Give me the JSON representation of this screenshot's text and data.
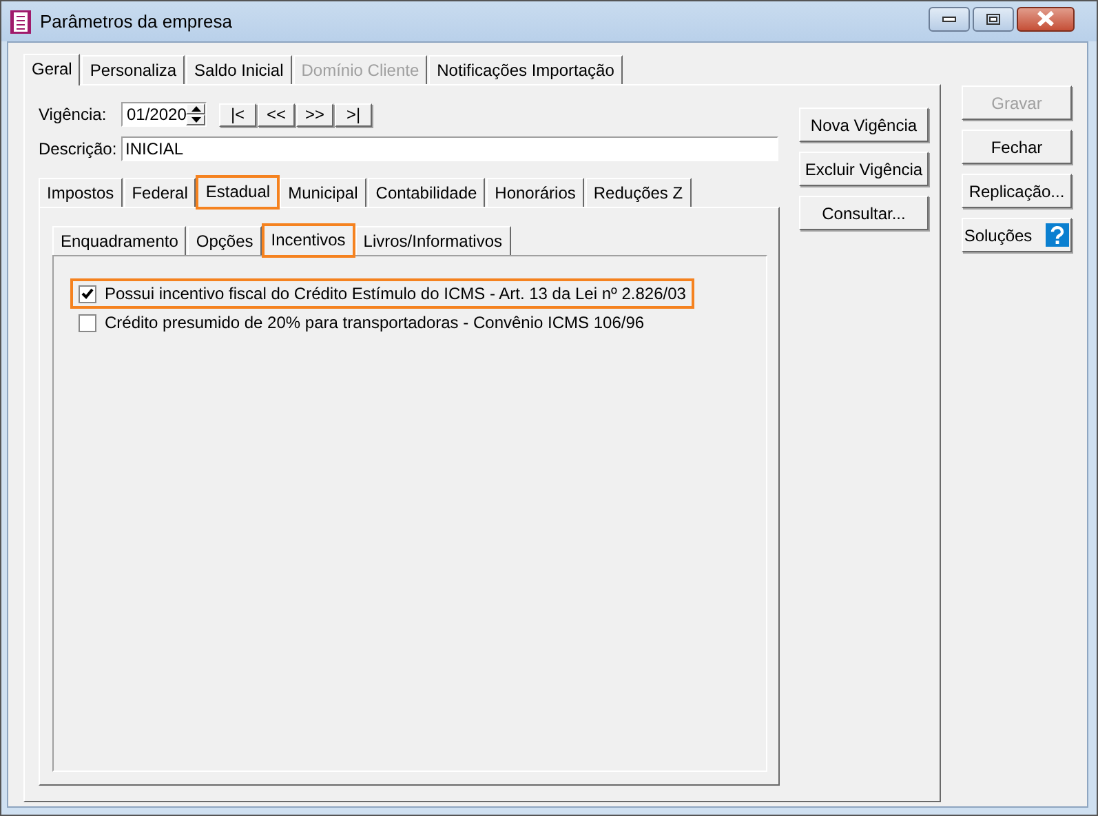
{
  "window": {
    "title": "Parâmetros da empresa"
  },
  "main_tabs": [
    {
      "label": "Geral",
      "selected": true,
      "disabled": false
    },
    {
      "label": "Personaliza",
      "selected": false,
      "disabled": false
    },
    {
      "label": "Saldo Inicial",
      "selected": false,
      "disabled": false
    },
    {
      "label": "Domínio Cliente",
      "selected": false,
      "disabled": true
    },
    {
      "label": "Notificações Importação",
      "selected": false,
      "disabled": false
    }
  ],
  "vigencia": {
    "label": "Vigência:",
    "value": "01/2020",
    "nav_buttons": [
      "|<",
      "<<",
      ">>",
      ">|"
    ]
  },
  "descricao": {
    "label": "Descrição:",
    "value": "INICIAL"
  },
  "tax_tabs": [
    {
      "label": "Impostos",
      "selected": false,
      "highlighted": false
    },
    {
      "label": "Federal",
      "selected": false,
      "highlighted": false
    },
    {
      "label": "Estadual",
      "selected": true,
      "highlighted": true
    },
    {
      "label": "Municipal",
      "selected": false,
      "highlighted": false
    },
    {
      "label": "Contabilidade",
      "selected": false,
      "highlighted": false
    },
    {
      "label": "Honorários",
      "selected": false,
      "highlighted": false
    },
    {
      "label": "Reduções Z",
      "selected": false,
      "highlighted": false
    }
  ],
  "state_tabs": [
    {
      "label": "Enquadramento",
      "selected": false,
      "highlighted": false
    },
    {
      "label": "Opções",
      "selected": false,
      "highlighted": false
    },
    {
      "label": "Incentivos",
      "selected": true,
      "highlighted": true
    },
    {
      "label": "Livros/Informativos",
      "selected": false,
      "highlighted": false
    }
  ],
  "incentives": [
    {
      "label": "Possui incentivo fiscal do Crédito Estímulo do ICMS - Art. 13 da Lei nº 2.826/03",
      "checked": true,
      "highlighted": true
    },
    {
      "label": "Crédito presumido de 20% para transportadoras - Convênio ICMS 106/96",
      "checked": false,
      "highlighted": false
    }
  ],
  "vigencia_buttons": [
    "Nova Vigência",
    "Excluir Vigência",
    "Consultar..."
  ],
  "side_buttons": [
    {
      "label": "Gravar",
      "disabled": true,
      "kind": "plain"
    },
    {
      "label": "Fechar",
      "disabled": false,
      "kind": "plain"
    },
    {
      "label": "Replicação...",
      "disabled": false,
      "kind": "plain"
    },
    {
      "label": "Soluções",
      "disabled": false,
      "kind": "help"
    }
  ]
}
